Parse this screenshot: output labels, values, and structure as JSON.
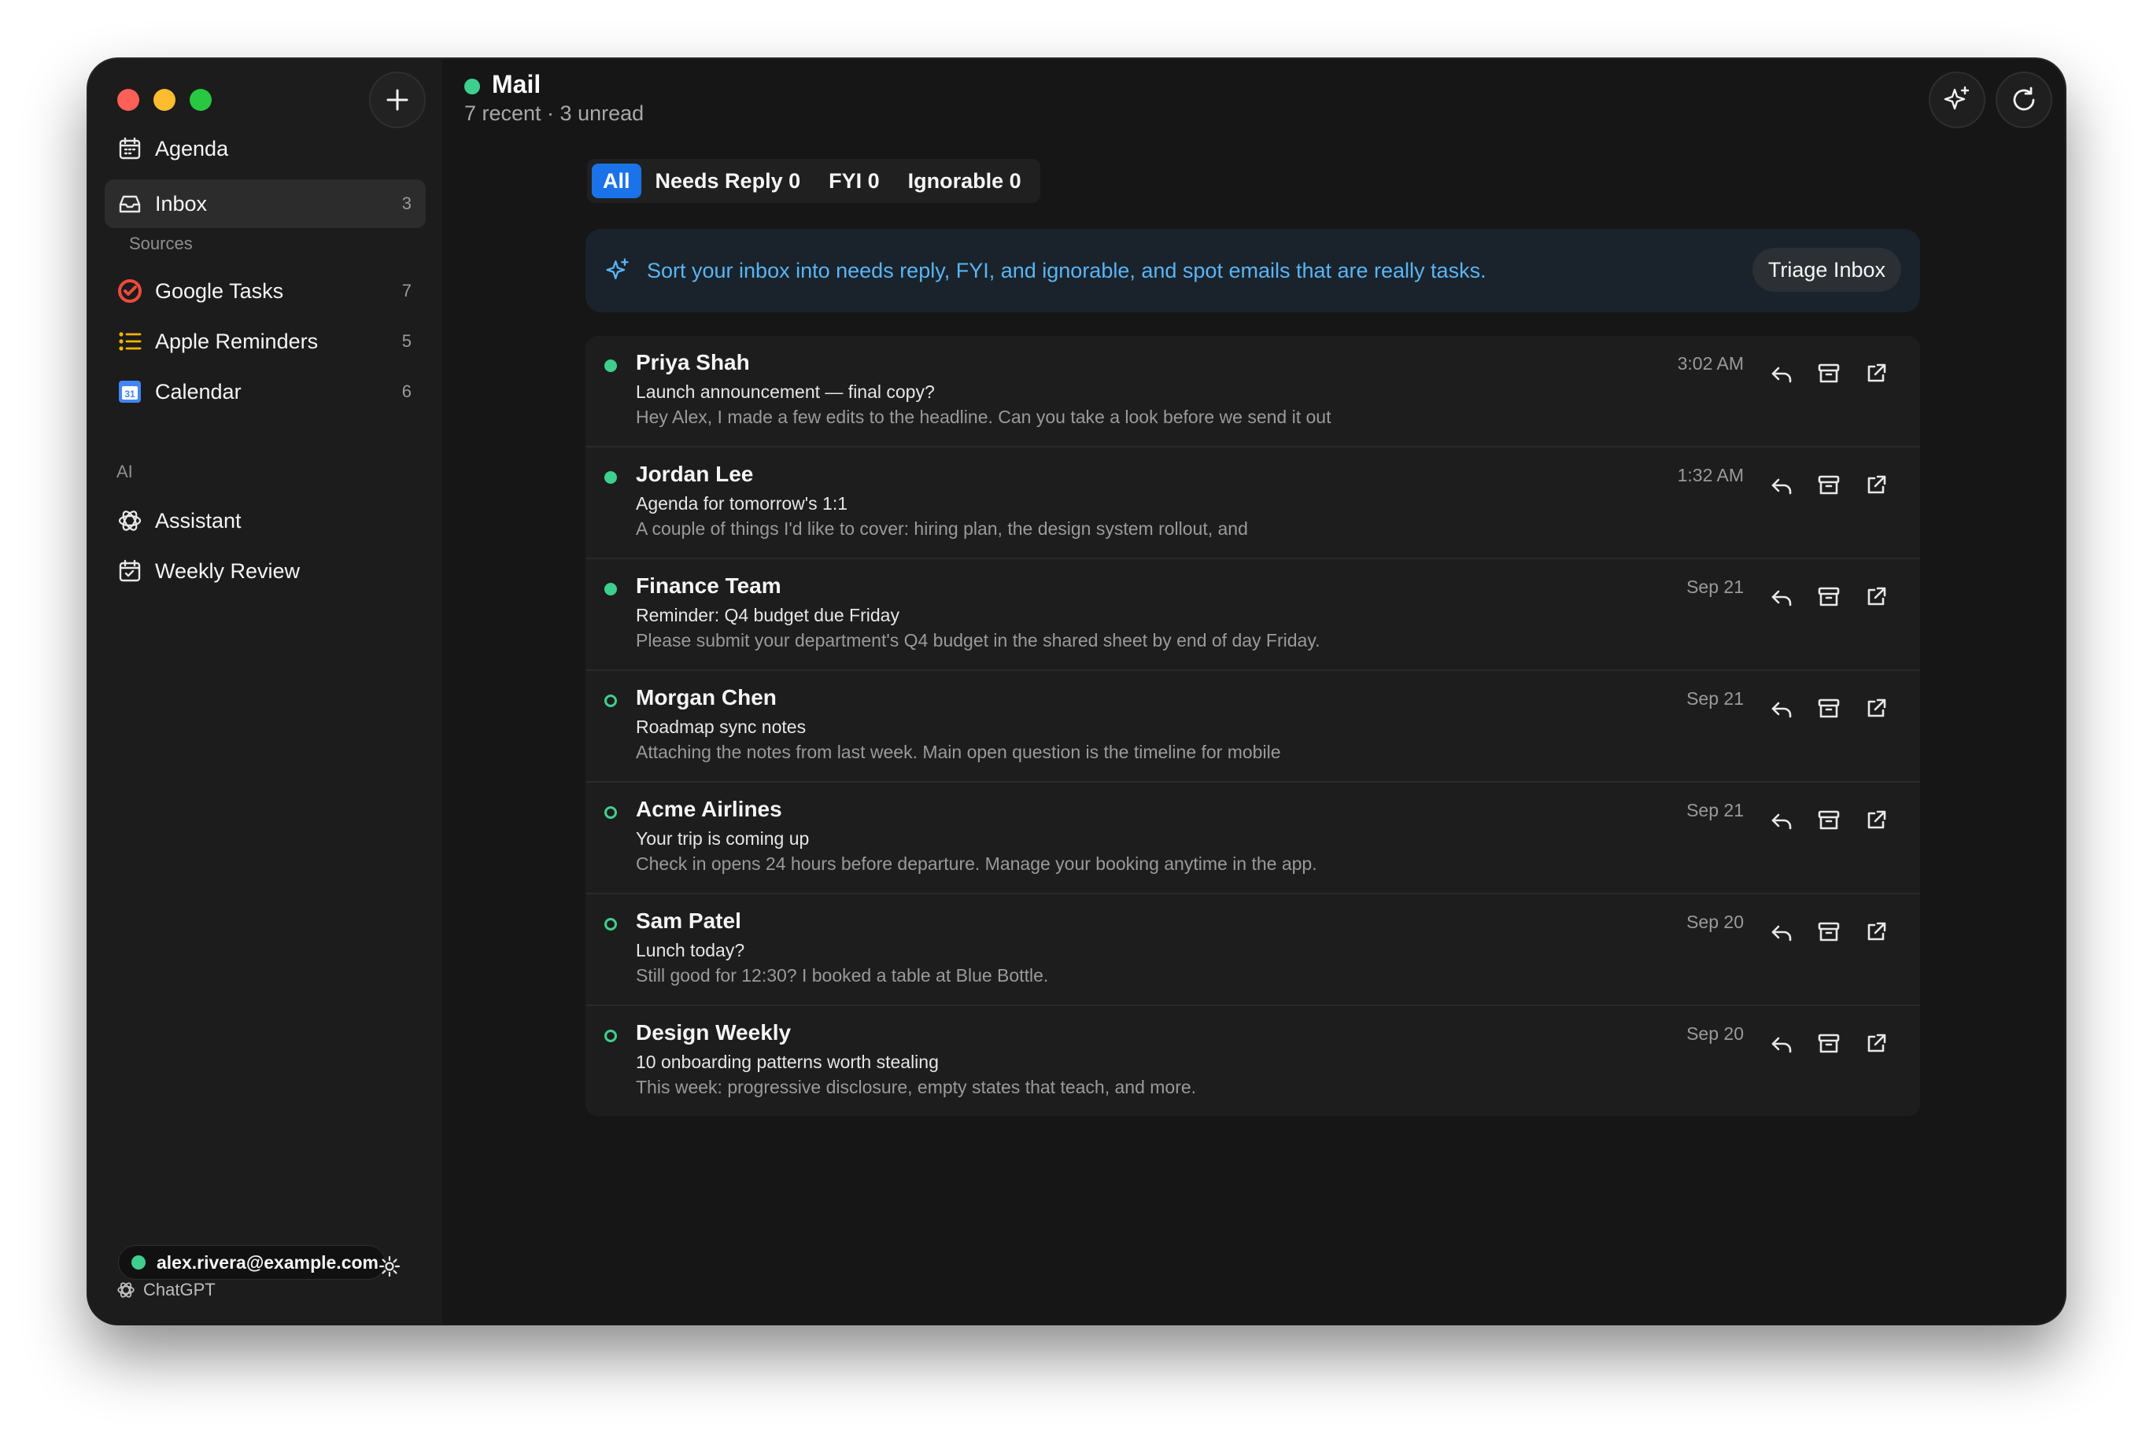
{
  "window": {
    "traffic_lights": [
      "close",
      "minimize",
      "zoom"
    ]
  },
  "sidebar": {
    "items": [
      {
        "label": "Agenda",
        "count": "",
        "icon": "calendar-icon"
      },
      {
        "label": "Inbox",
        "count": "3",
        "icon": "inbox-icon",
        "active": true
      }
    ],
    "sources_label": "Sources",
    "sources": [
      {
        "label": "Google Tasks",
        "count": "7",
        "icon": "google-tasks-icon"
      },
      {
        "label": "Apple Reminders",
        "count": "5",
        "icon": "list-icon"
      },
      {
        "label": "Calendar",
        "count": "6",
        "icon": "calendar-app-icon"
      }
    ],
    "ai_label": "AI",
    "ai_items": [
      {
        "label": "Assistant",
        "icon": "openai-icon"
      },
      {
        "label": "Weekly Review",
        "icon": "calendar-check-icon"
      }
    ],
    "account": {
      "email": "alex.rivera@example.com",
      "provider": "ChatGPT",
      "status_color": "#3ecf8e"
    }
  },
  "header": {
    "title": "Mail",
    "subtitle": "7 recent · 3 unread"
  },
  "filters": [
    {
      "label": "All",
      "active": true
    },
    {
      "label": "Needs Reply 0"
    },
    {
      "label": "FYI 0"
    },
    {
      "label": "Ignorable 0"
    }
  ],
  "banner": {
    "text": "Sort your inbox into needs reply, FYI, and ignorable, and spot emails that are really tasks.",
    "button": "Triage Inbox"
  },
  "emails": [
    {
      "sender": "Priya Shah",
      "subject": "Launch announcement — final copy?",
      "preview": "Hey Alex, I made a few edits to the headline. Can you take a look before we send it out",
      "time": "3:02 AM",
      "unread": true
    },
    {
      "sender": "Jordan Lee",
      "subject": "Agenda for tomorrow's 1:1",
      "preview": "A couple of things I'd like to cover: hiring plan, the design system rollout, and",
      "time": "1:32 AM",
      "unread": true
    },
    {
      "sender": "Finance Team",
      "subject": "Reminder: Q4 budget due Friday",
      "preview": "Please submit your department's Q4 budget in the shared sheet by end of day Friday.",
      "time": "Sep 21",
      "unread": true
    },
    {
      "sender": "Morgan Chen",
      "subject": "Roadmap sync notes",
      "preview": "Attaching the notes from last week. Main open question is the timeline for mobile",
      "time": "Sep 21",
      "unread": false
    },
    {
      "sender": "Acme Airlines",
      "subject": "Your trip is coming up",
      "preview": "Check in opens 24 hours before departure. Manage your booking anytime in the app.",
      "time": "Sep 21",
      "unread": false
    },
    {
      "sender": "Sam Patel",
      "subject": "Lunch today?",
      "preview": "Still good for 12:30? I booked a table at Blue Bottle.",
      "time": "Sep 20",
      "unread": false
    },
    {
      "sender": "Design Weekly",
      "subject": "10 onboarding patterns worth stealing",
      "preview": "This week: progressive disclosure, empty states that teach, and more.",
      "time": "Sep 20",
      "unread": false
    }
  ],
  "colors": {
    "accent": "#1a73e8",
    "link": "#5ab4f5",
    "unread_dot": "#3ecf8e"
  }
}
